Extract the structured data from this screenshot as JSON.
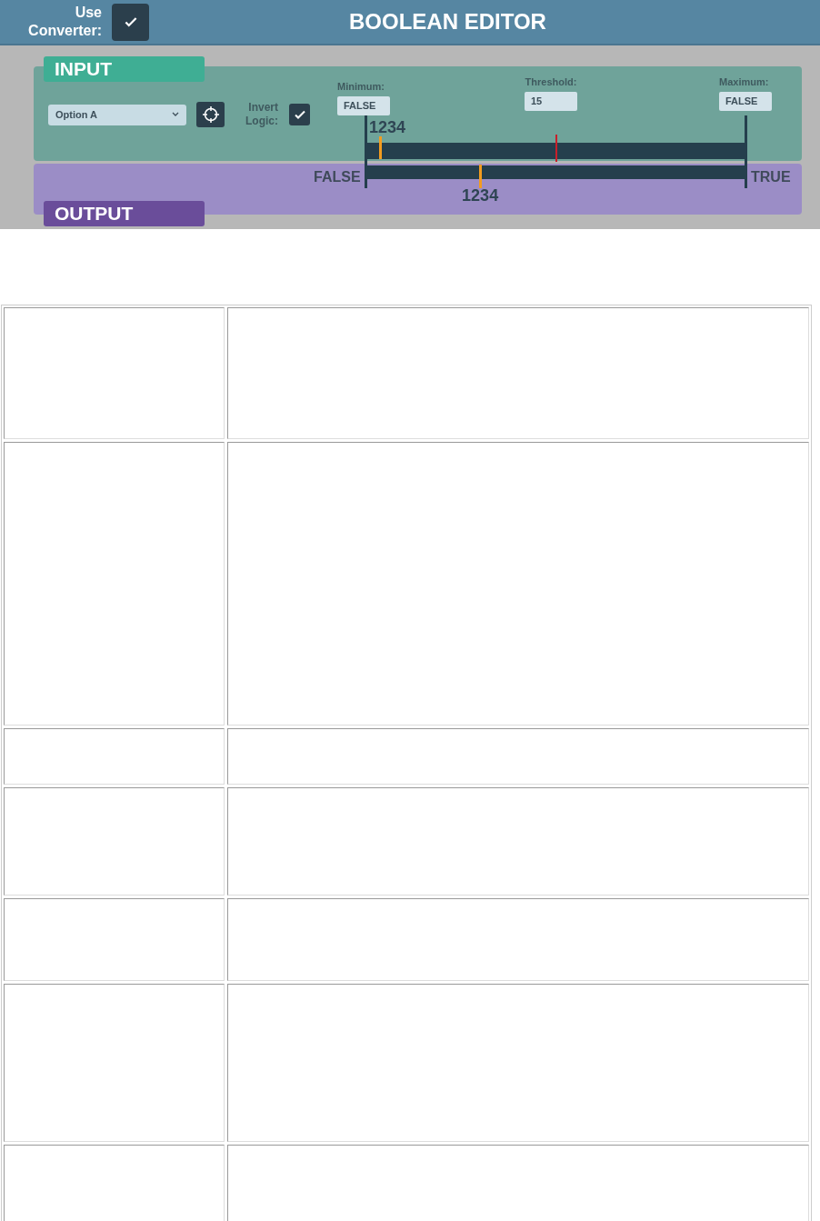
{
  "header": {
    "converter_label": "Use Converter:",
    "use_converter": {
      "checked": true
    },
    "title": "BOOLEAN EDITOR"
  },
  "input": {
    "tab": "INPUT",
    "dropdown": {
      "value": "Option A"
    },
    "invert_label": "Invert Logic:",
    "invert_logic": {
      "checked": true
    },
    "minimum": {
      "label": "Minimum:",
      "value": "FALSE"
    },
    "threshold": {
      "label": "Threshold:",
      "value": "15",
      "level": 0.5
    },
    "maximum": {
      "label": "Maximum:",
      "value": "FALSE"
    },
    "marker": {
      "label": "1234",
      "level": 0.036
    }
  },
  "output": {
    "tab": "OUTPUT",
    "false_label": "FALSE",
    "true_label": "TRUE",
    "marker": {
      "label": "1234",
      "level": 0.3
    }
  }
}
